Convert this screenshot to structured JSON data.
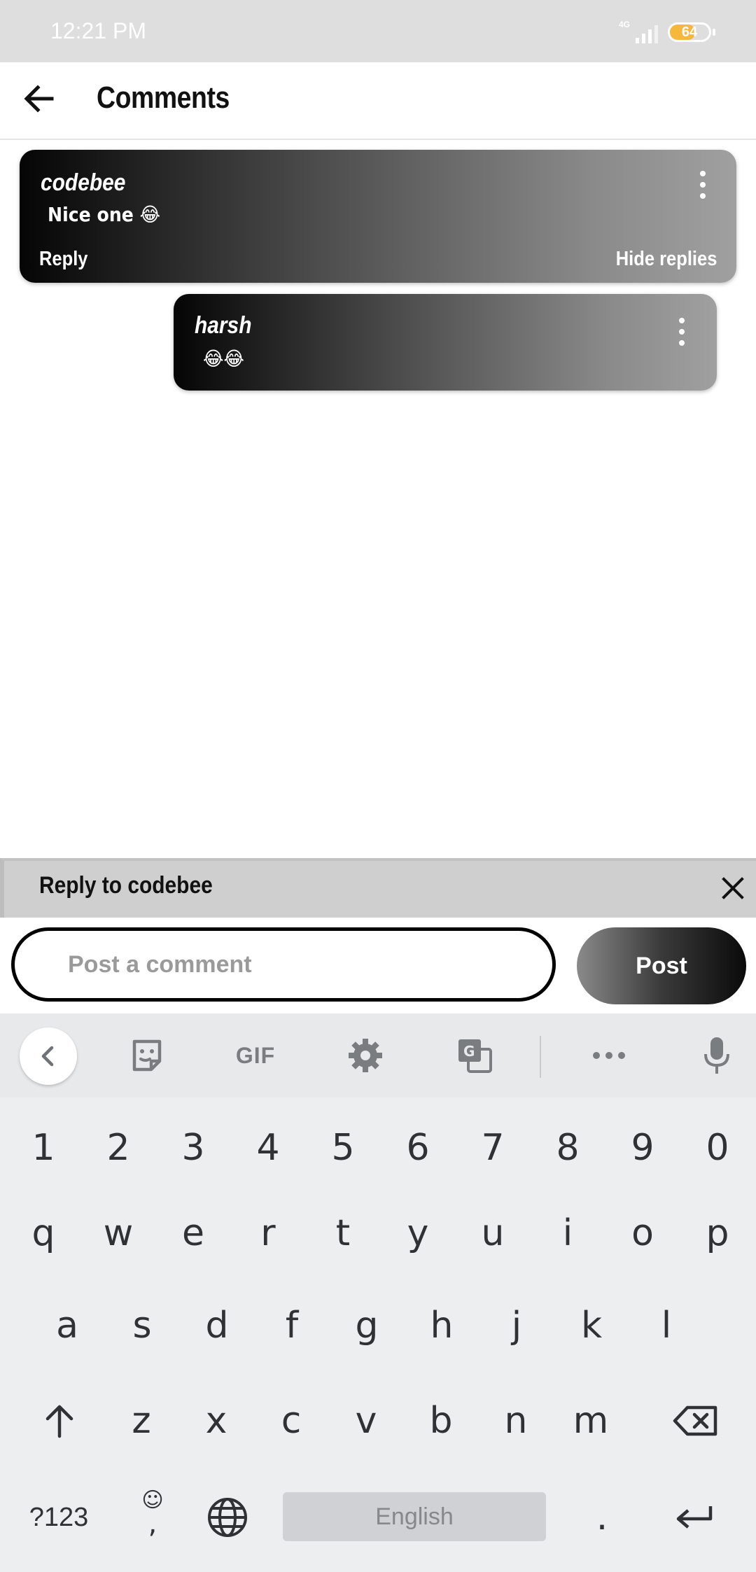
{
  "status_bar": {
    "time": "12:21 PM",
    "network": "4G",
    "battery": "64",
    "battery_level": 0.64
  },
  "header": {
    "title": "Comments"
  },
  "comments": [
    {
      "author": "codebee",
      "text": "Nice one 😂",
      "reply_label": "Reply",
      "hide_replies_label": "Hide replies"
    },
    {
      "author": "harsh",
      "text": "😂😂"
    }
  ],
  "reply_bar": {
    "label": "Reply to codebee"
  },
  "compose": {
    "placeholder": "Post a comment",
    "post_label": "Post"
  },
  "keyboard": {
    "toolbar": {
      "gif_label": "GIF"
    },
    "row_numbers": [
      "1",
      "2",
      "3",
      "4",
      "5",
      "6",
      "7",
      "8",
      "9",
      "0"
    ],
    "row_1": [
      "q",
      "w",
      "e",
      "r",
      "t",
      "y",
      "u",
      "i",
      "o",
      "p"
    ],
    "row_2": [
      "a",
      "s",
      "d",
      "f",
      "g",
      "h",
      "j",
      "k",
      "l"
    ],
    "row_3": [
      "z",
      "x",
      "c",
      "v",
      "b",
      "n",
      "m"
    ],
    "symbols_label": "?123",
    "comma": ",",
    "space_label": "English",
    "period": "."
  },
  "colors": {
    "card_gradient_start": "#050505",
    "card_gradient_end": "#a0a0a0",
    "keyboard_bg": "#eceef0"
  }
}
